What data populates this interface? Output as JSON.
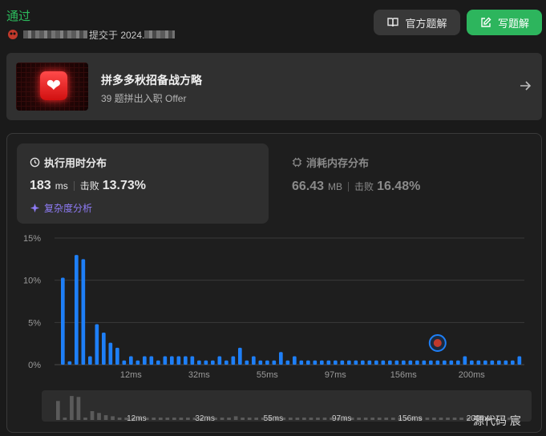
{
  "header": {
    "status": "通过",
    "submitted_prefix": "提交于 2024.",
    "official_solution_label": "官方题解",
    "write_solution_label": "写题解"
  },
  "banner": {
    "title": "拼多多秋招备战方略",
    "subtitle": "39 题拼出入职 Offer"
  },
  "runtime": {
    "title": "执行用时分布",
    "value": "183",
    "unit": "ms",
    "beat_label": "击败",
    "beat_value": "13.73%",
    "complexity_label": "复杂度分析"
  },
  "memory": {
    "title": "消耗内存分布",
    "value": "66.43",
    "unit": "MB",
    "beat_label": "击败",
    "beat_value": "16.48%"
  },
  "watermark": "源代码 宸",
  "colors": {
    "accent_green": "#2cbb5d",
    "bar_blue": "#1e7ff7",
    "complexity_purple": "#8f7cf7"
  },
  "chart_data": {
    "type": "bar",
    "ylabel_ticks": [
      "0%",
      "5%",
      "10%",
      "15%"
    ],
    "ylim": [
      0,
      15
    ],
    "xtick_labels": [
      "12ms",
      "32ms",
      "55ms",
      "97ms",
      "156ms",
      "200ms"
    ],
    "xtick_indices": [
      10,
      20,
      30,
      40,
      50,
      60
    ],
    "values": [
      10.3,
      0.4,
      13.0,
      12.5,
      1.0,
      4.8,
      3.8,
      2.6,
      2.0,
      0.5,
      1.0,
      0.5,
      1.0,
      1.0,
      0.5,
      1.0,
      1.0,
      1.0,
      1.0,
      1.0,
      0.5,
      0.5,
      0.5,
      1.0,
      0.5,
      1.0,
      2.0,
      0.5,
      1.0,
      0.5,
      0.5,
      0.5,
      1.5,
      0.5,
      1.0,
      0.5,
      0.5,
      0.5,
      0.5,
      0.5,
      0.5,
      0.5,
      0.5,
      0.5,
      0.5,
      0.5,
      0.5,
      0.5,
      0.5,
      0.5,
      0.5,
      0.5,
      0.5,
      0.5,
      0.5,
      0.5,
      0.5,
      0.5,
      0.5,
      1.0,
      0.5,
      0.5,
      0.5,
      0.5,
      0.5,
      0.5,
      0.5,
      1.0
    ],
    "highlight_index": 55
  }
}
